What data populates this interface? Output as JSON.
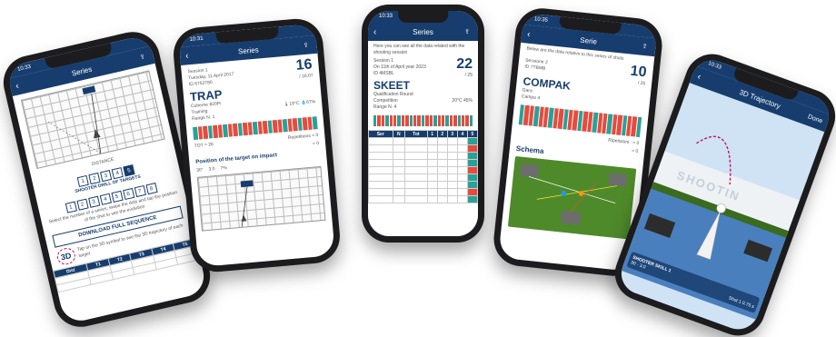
{
  "phone1": {
    "time": "10:33",
    "title": "Series",
    "distance_label": "DISTANCE",
    "position_numbers": [
      "1",
      "2",
      "3",
      "4",
      "5"
    ],
    "shot_label": "SHOOTER DRILL OF TARGETS",
    "target_numbers": [
      "1",
      "2",
      "3",
      "4",
      "5",
      "6",
      "7",
      "8"
    ],
    "caption": "Select the number of a series, swipe the dots and tap the position of the shot to see the evolution",
    "download_button": "DOWNLOAD FULL SEQUENCE",
    "badge_3d": "3D",
    "note": "Tap on the 3D symbol to see the 3D trajectory of each target",
    "table_headers": [
      "Dist",
      "T1",
      "T2",
      "T3",
      "T4",
      "T5"
    ]
  },
  "phone2": {
    "time": "10:31",
    "title": "Series",
    "session": "Session 1",
    "date": "Tuesday, 11 April 2017",
    "code": "ID 6752780",
    "score": "16",
    "score_total": "/ 16:07",
    "discipline": "TRAP",
    "weapon": "Cuberne 820Pi",
    "location": "Training",
    "range": "Range N. 1",
    "temp": "19°C",
    "humidity": "67%",
    "total_label": "TOT = 26",
    "repetitions_label": "Repetitions",
    "rep_val": "= 0",
    "tot_val": "= 0",
    "position_title": "Position of the target on impact",
    "deviation": "30°",
    "dev2": "3.0",
    "dev3": "7%"
  },
  "phone3": {
    "time": "10:33",
    "title": "Series",
    "intro": "Here you can see all the data related with the shooting session",
    "session": "Session 1",
    "date": "On 11th of April year 2023",
    "code": "ID 4MSBL",
    "score": "22",
    "score_sub": "/ 25",
    "discipline": "SKEET",
    "event": "Qualification Round",
    "location": "Competition",
    "range": "Range N. 4",
    "temp": "20°C",
    "humidity": "45%",
    "table_headers": [
      "Ser",
      "N",
      "Tot",
      "1",
      "2",
      "3",
      "4",
      "5"
    ]
  },
  "phone4": {
    "time": "10:35",
    "title": "Serie",
    "intro": "Below are the data relative to this series of shots",
    "session": "Sessione 2",
    "code": "ID 7TBMB",
    "score": "10",
    "score_sub": "/ 25",
    "discipline": "COMPAK",
    "location": "Gara",
    "range": "Campo 4",
    "repetitions_label": "Ripetizioni",
    "rep_val": "= 0",
    "tot_val": "= 0",
    "schema_title": "Schema"
  },
  "phone5": {
    "time": "10:33",
    "title": "3D Trajectory",
    "done": "Done",
    "brand": "SHOOTIN",
    "shooter": "SHOOTER SKILL 1",
    "shot": "Shot 1",
    "shot_val": "0.75 s",
    "score": "30",
    "dist": "3.0"
  },
  "colors": {
    "navy": "#173d6e",
    "hit_red": "#e84a3c",
    "miss_teal": "#2aa198",
    "grass": "#4f8a2a",
    "sky": "#cfe3f5"
  }
}
